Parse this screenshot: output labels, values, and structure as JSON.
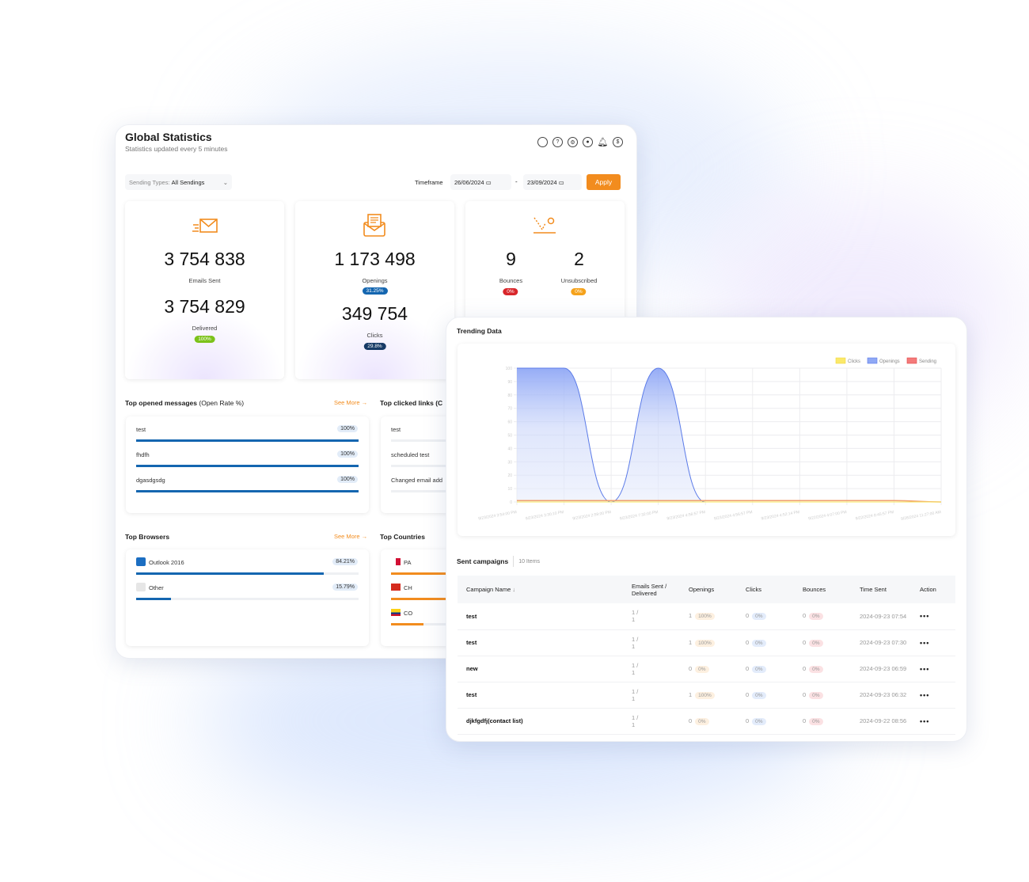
{
  "colors": {
    "accent": "#f28c1e",
    "bar_blue": "#1466b0",
    "openings": "#7f9cf5",
    "sending": "#f28c1e",
    "clicks": "#f7e65a"
  },
  "header": {
    "title": "Global Statistics",
    "subtitle": "Statistics updated every 5 minutes",
    "icons": [
      "search-icon",
      "help-icon",
      "settings-icon",
      "user-icon",
      "bell-icon",
      "dollar-icon"
    ]
  },
  "filters": {
    "sending_types_label": "Sending Types:",
    "sending_types_value": "All Sendings",
    "timeframe_label": "Timeframe",
    "date_from": "26/06/2024",
    "date_to": "23/09/2024",
    "separator": "-",
    "apply": "Apply"
  },
  "stats": {
    "emails_sent": {
      "value": "3 754 838",
      "label": "Emails Sent"
    },
    "delivered": {
      "value": "3 754 829",
      "label": "Delivered",
      "pct": "100%"
    },
    "openings": {
      "value": "1 173 498",
      "label": "Openings",
      "pct": "31.25%"
    },
    "clicks": {
      "value": "349 754",
      "label": "Clicks",
      "pct": "29.8%"
    },
    "bounces": {
      "value": "9",
      "label": "Bounces",
      "pct": "0%"
    },
    "unsubscribed": {
      "value": "2",
      "label": "Unsubscribed",
      "pct": "0%"
    }
  },
  "top_opened": {
    "title": "Top opened messages",
    "title_suffix": "(Open Rate %)",
    "see_more": "See More",
    "items": [
      {
        "name": "test",
        "pct": "100%",
        "value": 100
      },
      {
        "name": "fhdfh",
        "pct": "100%",
        "value": 100
      },
      {
        "name": "dgasdgsdg",
        "pct": "100%",
        "value": 100
      }
    ]
  },
  "top_clicked": {
    "title": "Top clicked links (C",
    "items": [
      "test",
      "scheduled test",
      "Changed email add"
    ]
  },
  "top_browsers": {
    "title": "Top Browsers",
    "see_more": "See More",
    "items": [
      {
        "name": "Outlook 2016",
        "pct": "84.21%",
        "value": 84.21
      },
      {
        "name": "Other",
        "pct": "15.79%",
        "value": 15.79
      }
    ]
  },
  "top_countries": {
    "title": "Top Countries",
    "items": [
      {
        "code": "PA",
        "value": 100
      },
      {
        "code": "CH",
        "value": 60
      },
      {
        "code": "CO",
        "value": 20
      }
    ]
  },
  "trending": {
    "title": "Trending Data"
  },
  "chart_data": {
    "type": "area",
    "legend": [
      "Clicks",
      "Openings",
      "Sending"
    ],
    "legend_position": "top-right",
    "grid": true,
    "ylim": [
      0,
      100
    ],
    "yticks": [
      0,
      10,
      20,
      30,
      40,
      50,
      60,
      70,
      80,
      90,
      100
    ],
    "categories": [
      "9/23/2024 3:54:00 PM",
      "9/23/2024 3:30:10 PM",
      "9/23/2024 2:59:00 PM",
      "9/23/2024 7:32:00 PM",
      "9/23/2024 4:56:57 PM",
      "9/23/2024 4:56:57 PM",
      "9/23/2024 4:52:14 PM",
      "9/22/2024 4:07:00 PM",
      "9/22/2024 8:45:57 PM",
      "9/28/2024 11:27:00 AM"
    ],
    "series": [
      {
        "name": "Clicks",
        "values": [
          0,
          0,
          0,
          0,
          0,
          0,
          0,
          0,
          0,
          0
        ]
      },
      {
        "name": "Openings",
        "values": [
          100,
          100,
          0,
          100,
          0,
          0,
          0,
          0,
          0,
          0
        ]
      },
      {
        "name": "Sending",
        "values": [
          1,
          1,
          1,
          1,
          1,
          1,
          1,
          1,
          1,
          0
        ]
      }
    ]
  },
  "campaigns": {
    "title": "Sent campaigns",
    "count": "10 Items",
    "columns": [
      "Campaign Name",
      "Emails Sent / Delivered",
      "Openings",
      "Clicks",
      "Bounces",
      "Time Sent",
      "Action"
    ],
    "rows": [
      {
        "name": "test",
        "sent": "1 /",
        "delivered": "1",
        "openings": "1",
        "openings_pct": "100%",
        "clicks": "0",
        "clicks_pct": "0%",
        "bounces": "0",
        "bounces_pct": "0%",
        "time": "2024-09-23 07:54"
      },
      {
        "name": "test",
        "sent": "1 /",
        "delivered": "1",
        "openings": "1",
        "openings_pct": "100%",
        "clicks": "0",
        "clicks_pct": "0%",
        "bounces": "0",
        "bounces_pct": "0%",
        "time": "2024-09-23 07:30"
      },
      {
        "name": "new",
        "sent": "1 /",
        "delivered": "1",
        "openings": "0",
        "openings_pct": "0%",
        "clicks": "0",
        "clicks_pct": "0%",
        "bounces": "0",
        "bounces_pct": "0%",
        "time": "2024-09-23 06:59"
      },
      {
        "name": "test",
        "sent": "1 /",
        "delivered": "1",
        "openings": "1",
        "openings_pct": "100%",
        "clicks": "0",
        "clicks_pct": "0%",
        "bounces": "0",
        "bounces_pct": "0%",
        "time": "2024-09-23 06:32"
      },
      {
        "name": "djkfgdfj(contact list)",
        "sent": "1 /",
        "delivered": "1",
        "openings": "0",
        "openings_pct": "0%",
        "clicks": "0",
        "clicks_pct": "0%",
        "bounces": "0",
        "bounces_pct": "0%",
        "time": "2024-09-22 08:56"
      }
    ],
    "action_label": "•••"
  }
}
